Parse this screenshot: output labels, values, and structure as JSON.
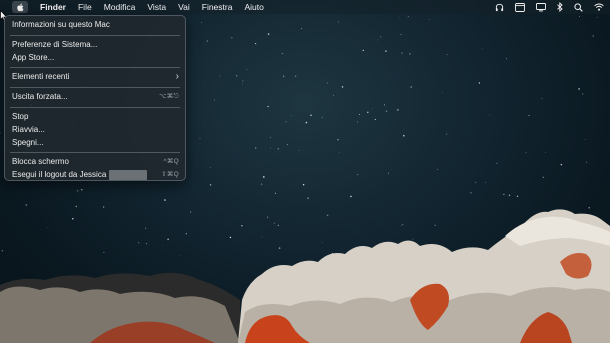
{
  "menubar": {
    "apple_icon": "apple-icon",
    "items": [
      {
        "label": "Finder",
        "bold": true
      },
      {
        "label": "File"
      },
      {
        "label": "Modifica"
      },
      {
        "label": "Vista"
      },
      {
        "label": "Vai"
      },
      {
        "label": "Finestra"
      },
      {
        "label": "Aiuto"
      }
    ],
    "status_icons": [
      "headphones-icon",
      "window-icon",
      "display-icon",
      "bluetooth-icon",
      "search-icon",
      "wifi-icon"
    ]
  },
  "apple_menu": {
    "about": "Informazioni su questo Mac",
    "system_prefs": "Preferenze di Sistema...",
    "app_store": "App Store...",
    "recent_items": "Elementi recenti",
    "recent_items_arrow": "›",
    "force_quit": "Uscita forzata...",
    "force_quit_shortcut": "⌥⌘⎋",
    "sleep": "Stop",
    "restart": "Riavvia...",
    "shutdown": "Spegni...",
    "lock_screen": "Blocca schermo",
    "lock_screen_shortcut": "^⌘Q",
    "logout": "Esegui il logout da Jessica",
    "logout_shortcut": "⇧⌘Q"
  },
  "colors": {
    "sky": "#0a1820",
    "menu_bg": "#20282e",
    "rock": "#d8d2c8",
    "rock_red": "#c0401e"
  }
}
